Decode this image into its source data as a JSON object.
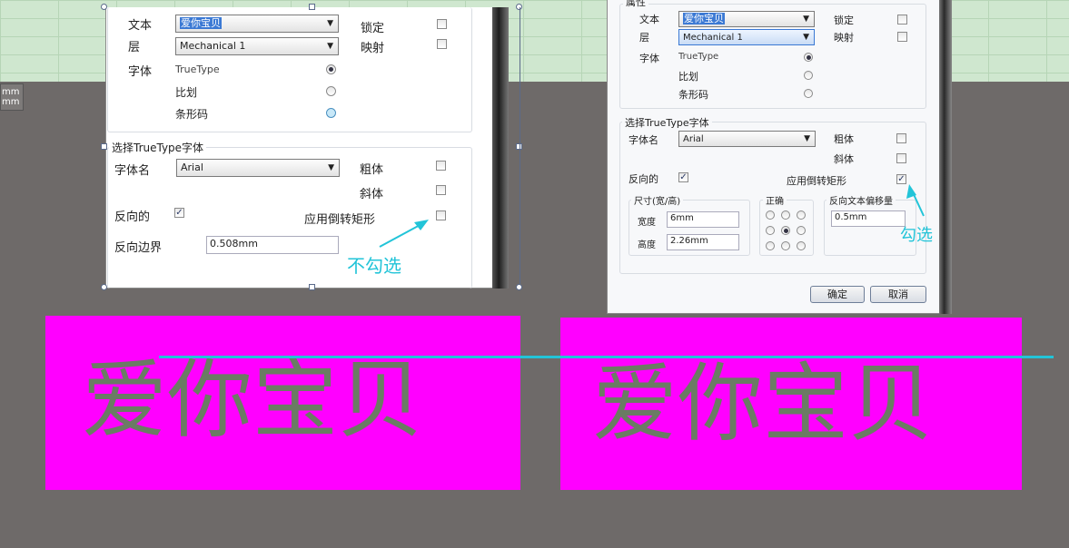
{
  "left_dialog": {
    "text_label": "文本",
    "text_value": "爱你宝贝",
    "layer_label": "层",
    "layer_value": "Mechanical 1",
    "lock_label": "锁定",
    "mirror_label": "映射",
    "font_label": "字体",
    "font_options": [
      "TrueType",
      "比划",
      "条形码"
    ],
    "group_title": "选择TrueType字体",
    "font_name_label": "字体名",
    "font_name_value": "Arial",
    "bold_label": "粗体",
    "italic_label": "斜体",
    "inverted_label": "反向的",
    "inverted_rect_label": "应用倒转矩形",
    "inverted_border_label": "反向边界",
    "inverted_border_value": "0.508mm",
    "annotation": "不勾选"
  },
  "right_dialog": {
    "props_title": "属性",
    "text_label": "文本",
    "text_value": "爱你宝贝",
    "layer_label": "层",
    "layer_value": "Mechanical 1",
    "lock_label": "锁定",
    "mirror_label": "映射",
    "font_label": "字体",
    "font_options": [
      "TrueType",
      "比划",
      "条形码"
    ],
    "group_title": "选择TrueType字体",
    "font_name_label": "字体名",
    "font_name_value": "Arial",
    "bold_label": "粗体",
    "italic_label": "斜体",
    "inverted_label": "反向的",
    "inverted_rect_label": "应用倒转矩形",
    "size_group_title": "尺寸(宽/高)",
    "width_label": "宽度",
    "width_value": "6mm",
    "height_label": "高度",
    "height_value": "2.26mm",
    "justify_title": "正确",
    "offset_title": "反向文本偏移量",
    "offset_value": "0.5mm",
    "ok_label": "确定",
    "cancel_label": "取消",
    "annotation": "勾选"
  },
  "left_label": [
    "mm",
    "mm"
  ],
  "canvas_text_left": "爱你宝贝",
  "canvas_text_right": "爱你宝贝",
  "colors": {
    "magenta": "#ff00ff",
    "annotation": "#22c4d8",
    "canvas": "#6e6a69"
  }
}
